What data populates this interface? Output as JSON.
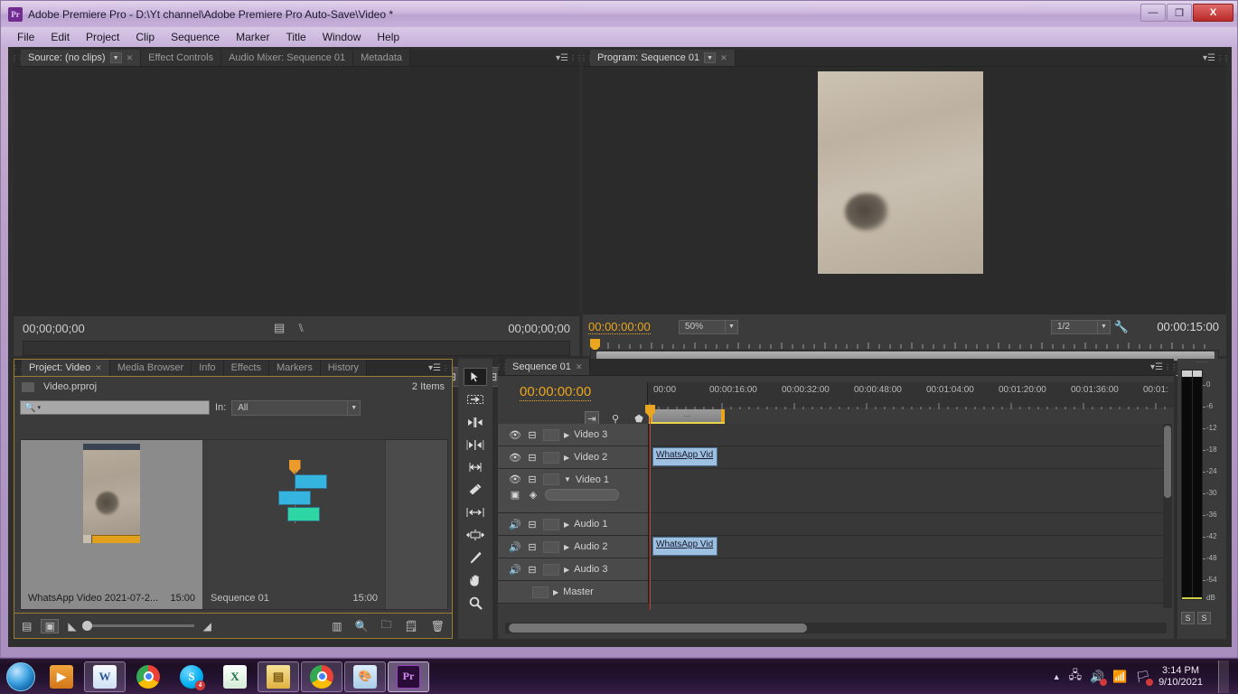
{
  "window": {
    "title": "Adobe Premiere Pro - D:\\Yt channel\\Adobe Premiere Pro Auto-Save\\Video *",
    "logo_text": "Pr",
    "minimize": "—",
    "maximize": "❐",
    "close": "X"
  },
  "menubar": {
    "items": [
      "File",
      "Edit",
      "Project",
      "Clip",
      "Sequence",
      "Marker",
      "Title",
      "Window",
      "Help"
    ]
  },
  "source_monitor": {
    "tabs": [
      {
        "label": "Source: (no clips)",
        "active": true,
        "has_caret": true,
        "has_close": true
      },
      {
        "label": "Effect Controls",
        "active": false
      },
      {
        "label": "Audio Mixer: Sequence 01",
        "active": false
      },
      {
        "label": "Metadata",
        "active": false
      }
    ],
    "timecode_left": "00;00;00;00",
    "timecode_right": "00;00;00;00",
    "buttons": [
      "marker",
      "mark-in",
      "mark-out",
      "go-to-in",
      "step-back",
      "play",
      "step-forward",
      "go-to-out",
      "insert",
      "overwrite",
      "export-frame"
    ],
    "add-button": "+"
  },
  "program_monitor": {
    "tabs": [
      {
        "label": "Program: Sequence 01",
        "active": true,
        "has_caret": true,
        "has_close": true
      }
    ],
    "timecode_current": "00:00:00:00",
    "zoom_level": "50%",
    "quality": "1/2",
    "duration": "00:00:15:00",
    "buttons": [
      "marker",
      "mark-in",
      "mark-out",
      "go-to-in",
      "step-back",
      "play",
      "step-forward",
      "go-to-out",
      "lift",
      "extract",
      "export-frame"
    ],
    "add_button": "+"
  },
  "project_panel": {
    "tabs": [
      {
        "label": "Project: Video",
        "active": true,
        "has_close": true
      },
      {
        "label": "Media Browser",
        "active": false
      },
      {
        "label": "Info",
        "active": false
      },
      {
        "label": "Effects",
        "active": false
      },
      {
        "label": "Markers",
        "active": false
      },
      {
        "label": "History",
        "active": false
      }
    ],
    "project_name": "Video.prproj",
    "item_count": "2 Items",
    "search_placeholder": "",
    "search_value": "",
    "filter_label": "In:",
    "filter_value": "All",
    "items": [
      {
        "name": "WhatsApp Video 2021-07-2...",
        "duration": "15:00",
        "selected": true
      },
      {
        "name": "Sequence 01",
        "duration": "15:00",
        "selected": false
      }
    ],
    "bottom_icons": [
      "list-view-icon",
      "icon-view-icon",
      "zoom-out-icon",
      "zoom-in-icon",
      "freeform-icon",
      "find-icon",
      "new-bin-icon",
      "new-item-icon",
      "delete-icon"
    ]
  },
  "tools": [
    {
      "name": "selection-tool",
      "glyph": "➤",
      "active": true
    },
    {
      "name": "track-select-tool",
      "glyph": "⇥"
    },
    {
      "name": "ripple-edit-tool",
      "glyph": "◄►"
    },
    {
      "name": "rolling-edit-tool",
      "glyph": "◄|►"
    },
    {
      "name": "rate-stretch-tool",
      "glyph": "↔"
    },
    {
      "name": "razor-tool",
      "glyph": "✂"
    },
    {
      "name": "slip-tool",
      "glyph": "|↔|"
    },
    {
      "name": "slide-tool",
      "glyph": "⇕"
    },
    {
      "name": "pen-tool",
      "glyph": "✎"
    },
    {
      "name": "hand-tool",
      "glyph": "✋"
    },
    {
      "name": "zoom-tool",
      "glyph": "🔍"
    }
  ],
  "timeline": {
    "tabs": [
      {
        "label": "Sequence 01",
        "active": true,
        "has_close": true
      }
    ],
    "timecode": "00:00:00:00",
    "ruler_labels": [
      "00:00",
      "00:00:16:00",
      "00:00:32:00",
      "00:00:48:00",
      "00:01:04:00",
      "00:01:20:00",
      "00:01:36:00",
      "00:01:"
    ],
    "header_icons": [
      "snap-icon",
      "linked-selection-icon",
      "add-marker-icon"
    ],
    "tracks": [
      {
        "name": "Video 3",
        "type": "video",
        "clips": []
      },
      {
        "name": "Video 2",
        "type": "video",
        "clips": [
          {
            "label": "WhatsApp Vid"
          }
        ]
      },
      {
        "name": "Video 1",
        "type": "video",
        "expanded": true,
        "clips": []
      },
      {
        "name": "Audio 1",
        "type": "audio",
        "clips": []
      },
      {
        "name": "Audio 2",
        "type": "audio",
        "clips": [
          {
            "label": "WhatsApp Vid"
          }
        ]
      },
      {
        "name": "Audio 3",
        "type": "audio",
        "clips": []
      },
      {
        "name": "Master",
        "type": "master",
        "clips": []
      }
    ]
  },
  "audio_meters": {
    "scale": [
      "0",
      "-6",
      "-12",
      "-18",
      "-24",
      "-30",
      "-36",
      "-42",
      "-48",
      "-54",
      "dB"
    ],
    "solo_buttons": [
      "S",
      "S"
    ]
  },
  "taskbar": {
    "start_label": "Start",
    "items": [
      {
        "name": "windows-media-player",
        "glyph": "▶",
        "color": "#e28b2a",
        "framed": false
      },
      {
        "name": "microsoft-word",
        "glyph": "W",
        "color": "#2b5797",
        "framed": true
      },
      {
        "name": "google-chrome",
        "glyph": "",
        "color": "#34a853",
        "framed": false
      },
      {
        "name": "skype",
        "glyph": "S",
        "color": "#00aff0",
        "framed": false,
        "badge": "4"
      },
      {
        "name": "microsoft-excel",
        "glyph": "X",
        "color": "#1d7044",
        "framed": false
      },
      {
        "name": "folder-windows",
        "glyph": "▣",
        "color": "#e8c44a",
        "framed": true
      },
      {
        "name": "google-chrome-2",
        "glyph": "",
        "color": "#34a853",
        "framed": true
      },
      {
        "name": "microsoft-paint",
        "glyph": "🎨",
        "color": "#b8d4e8",
        "framed": true
      },
      {
        "name": "adobe-premiere-pro",
        "glyph": "Pr",
        "color": "#6f2b8f",
        "framed": true,
        "active": true
      }
    ],
    "tray": {
      "show_hidden": "▲",
      "icons": [
        "network-icon",
        "volume-icon",
        "signal-icon",
        "action-center-icon"
      ],
      "time": "3:14 PM",
      "date": "9/10/2021"
    }
  },
  "colors": {
    "accent_orange": "#e9a61e",
    "playhead_red": "#c4432e",
    "clip_blue": "#9dbfe0",
    "panel_bg": "#3b3b3b",
    "window_chrome": "#c6b0d9"
  }
}
